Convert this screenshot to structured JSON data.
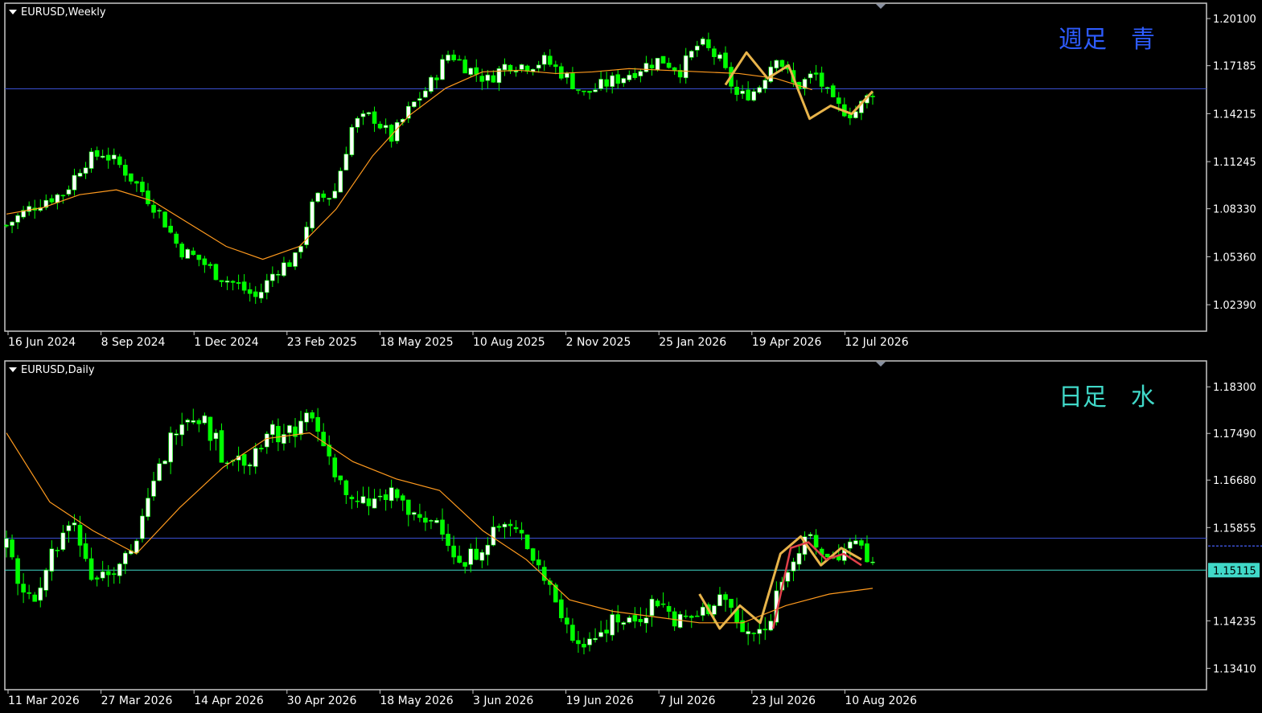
{
  "colors": {
    "background": "#000000",
    "frame": "#c8c8c8",
    "bull_candle": "#ffffff",
    "bear_candle": "#00ff00",
    "wick": "#00ff00",
    "ma": "#ff9a1e",
    "zigzag": "#e8b44a",
    "zigzag_red": "#e0404a",
    "hline_blue": "#3a4fd0",
    "hline_aqua": "#40d8c8",
    "note_weekly": "#2e5cff",
    "note_daily": "#40d8c8",
    "price_tag_bg": "#40d8c8"
  },
  "chart_data": [
    {
      "type": "candlestick",
      "title": "EURUSD,Weekly",
      "note": "週足　青",
      "x_tick_labels": [
        "16 Jun 2024",
        "8 Sep 2024",
        "1 Dec 2024",
        "23 Feb 2025",
        "18 May 2025",
        "10 Aug 2025",
        "2 Nov 2025",
        "25 Jan 2026",
        "19 Apr 2026",
        "12 Jul 2026"
      ],
      "y_tick_labels": [
        "1.20100",
        "1.17185",
        "1.14215",
        "1.11245",
        "1.08330",
        "1.05360",
        "1.02390"
      ],
      "ylim": [
        1.0115,
        1.2105
      ],
      "grid": false,
      "hlines": [
        {
          "value": 1.1575,
          "color": "#3a4fd0"
        }
      ],
      "anchors": [
        1.073,
        1.082,
        1.089,
        1.093,
        1.112,
        1.118,
        1.109,
        1.095,
        1.08,
        1.058,
        1.052,
        1.042,
        1.036,
        1.028,
        1.046,
        1.052,
        1.089,
        1.092,
        1.136,
        1.141,
        1.127,
        1.146,
        1.16,
        1.18,
        1.17,
        1.163,
        1.173,
        1.172,
        1.175,
        1.166,
        1.154,
        1.16,
        1.165,
        1.171,
        1.176,
        1.169,
        1.186,
        1.176,
        1.152,
        1.157,
        1.179,
        1.158,
        1.167,
        1.147,
        1.142,
        1.156
      ],
      "ma": [
        1.08,
        1.084,
        1.092,
        1.095,
        1.088,
        1.074,
        1.06,
        1.052,
        1.06,
        1.083,
        1.116,
        1.141,
        1.158,
        1.168,
        1.169,
        1.167,
        1.168,
        1.17,
        1.169,
        1.168,
        1.167,
        1.164,
        1.157
      ],
      "zigzag": [
        1.16,
        1.18,
        1.164,
        1.172,
        1.139,
        1.147,
        1.142,
        1.156
      ],
      "zigzag_red": []
    },
    {
      "type": "candlestick",
      "title": "EURUSD,Daily",
      "note": "日足　水",
      "x_tick_labels": [
        "11 Mar 2026",
        "27 Mar 2026",
        "14 Apr 2026",
        "30 Apr 2026",
        "18 May 2026",
        "3 Jun 2026",
        "19 Jun 2026",
        "7 Jul 2026",
        "23 Jul 2026",
        "10 Aug 2026"
      ],
      "y_tick_labels": [
        "1.18300",
        "1.17490",
        "1.16680",
        "1.15855",
        "1.14235",
        "1.13410"
      ],
      "ylim": [
        1.1315,
        1.1875
      ],
      "grid": false,
      "hlines": [
        {
          "value": 1.1567,
          "color": "#3a4fd0"
        },
        {
          "value": 1.15115,
          "color": "#40d8c8"
        }
      ],
      "price_tag": "1.15115",
      "anchors": [
        1.155,
        1.145,
        1.153,
        1.16,
        1.15,
        1.152,
        1.156,
        1.168,
        1.178,
        1.178,
        1.171,
        1.17,
        1.175,
        1.175,
        1.178,
        1.17,
        1.162,
        1.163,
        1.164,
        1.159,
        1.16,
        1.151,
        1.156,
        1.159,
        1.156,
        1.149,
        1.14,
        1.139,
        1.143,
        1.142,
        1.146,
        1.142,
        1.143,
        1.147,
        1.14,
        1.14,
        1.152,
        1.156,
        1.153,
        1.155,
        1.153
      ],
      "ma": [
        1.175,
        1.163,
        1.158,
        1.154,
        1.162,
        1.169,
        1.174,
        1.175,
        1.17,
        1.167,
        1.165,
        1.158,
        1.153,
        1.146,
        1.144,
        1.143,
        1.142,
        1.142,
        1.145,
        1.147,
        1.148
      ],
      "zigzag": [
        1.147,
        1.141,
        1.145,
        1.142,
        1.154,
        1.157,
        1.152,
        1.155,
        1.153
      ],
      "zigzag_red": [
        1.141,
        1.155,
        1.156,
        1.153,
        1.154,
        1.152
      ]
    }
  ]
}
